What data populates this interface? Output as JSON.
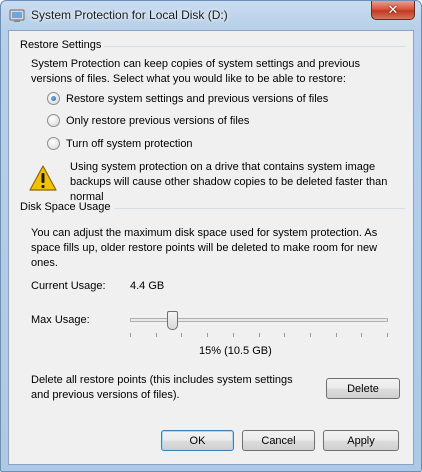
{
  "window": {
    "title": "System Protection for Local Disk (D:)",
    "close_glyph": "✕"
  },
  "restore_settings": {
    "group_title": "Restore Settings",
    "description": "System Protection can keep copies of system settings and previous versions of files. Select what you would like to be able to restore:",
    "options": [
      {
        "label": "Restore system settings and previous versions of files",
        "checked": true
      },
      {
        "label": "Only restore previous versions of files",
        "checked": false
      },
      {
        "label": "Turn off system protection",
        "checked": false
      }
    ],
    "warning": "Using system protection on a drive that contains system image backups will cause other shadow copies to be deleted faster than normal"
  },
  "disk_space": {
    "group_title": "Disk Space Usage",
    "description": "You can adjust the maximum disk space used for system protection. As space fills up, older restore points will be deleted to make room for new ones.",
    "current_usage_label": "Current Usage:",
    "current_usage_value": "4.4 GB",
    "max_usage_label": "Max Usage:",
    "max_usage_percent": 15,
    "max_usage_readout": "15% (10.5 GB)",
    "delete_description": "Delete all restore points (this includes system settings and previous versions of files).",
    "delete_button": "Delete"
  },
  "buttons": {
    "ok": "OK",
    "cancel": "Cancel",
    "apply": "Apply"
  },
  "colors": {
    "title_gradient_top": "#c9dcf1",
    "close_button": "#c23a22",
    "client_background": "#f0f0f0",
    "warning_yellow": "#f2c200"
  }
}
